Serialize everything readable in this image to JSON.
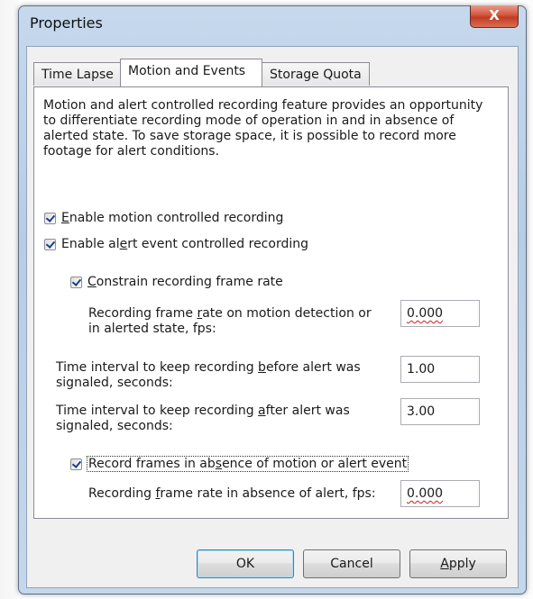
{
  "window": {
    "title": "Properties",
    "close_glyph": "X"
  },
  "tabs": [
    {
      "label": "Time Lapse",
      "active": false
    },
    {
      "label": "Motion and Events",
      "active": true
    },
    {
      "label": "Storage Quota",
      "active": false
    }
  ],
  "description": "Motion and alert controlled recording feature provides an opportunity to differentiate recording mode of operation in and in absence of alerted state. To save storage space, it is possible to record more footage for alert conditions.",
  "options": {
    "enable_motion": {
      "label_pre": "",
      "mnemonic": "E",
      "label_post": "nable motion controlled recording",
      "checked": true
    },
    "enable_alert": {
      "label_pre": "Enable al",
      "mnemonic": "e",
      "label_post": "rt event controlled recording",
      "checked": true
    },
    "constrain_rate": {
      "label_pre": "",
      "mnemonic": "C",
      "label_post": "onstrain recording frame rate",
      "checked": true
    },
    "record_absence": {
      "label_pre": "Record frames in ab",
      "mnemonic": "s",
      "label_post": "ence of motion or alert event",
      "checked": true
    }
  },
  "fields": {
    "motion_rate": {
      "label_pre": "Recording frame ",
      "mnemonic": "r",
      "label_post": "ate on motion detection or in alerted state, fps:",
      "value": "0.000"
    },
    "before_alert": {
      "label_pre": "Time interval to keep recording ",
      "mnemonic": "b",
      "label_post": "efore alert was signaled, seconds:",
      "value": "1.00"
    },
    "after_alert": {
      "label_pre": "Time interval to keep recording ",
      "mnemonic": "a",
      "label_post": "fter alert was signaled, seconds:",
      "value": "3.00"
    },
    "absence_rate": {
      "label_pre": "Recording ",
      "mnemonic": "f",
      "label_post": "rame rate in absence of alert, fps:",
      "value": "0.000"
    }
  },
  "buttons": {
    "ok": "OK",
    "cancel": "Cancel",
    "apply_mnemonic": "A",
    "apply_rest": "pply"
  },
  "colors": {
    "accent": "#3c7fb1",
    "close": "#c23a22",
    "spell_error": "#d41c1c"
  }
}
